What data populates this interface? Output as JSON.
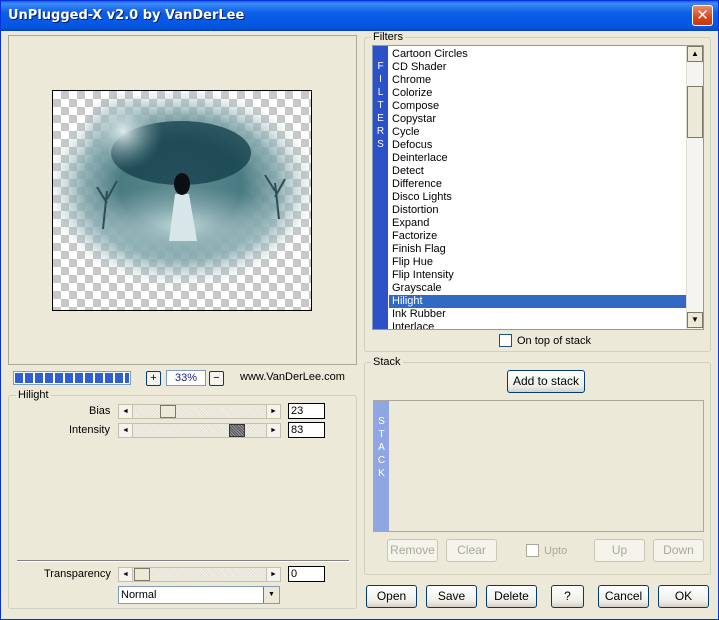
{
  "window": {
    "title": "UnPlugged-X v2.0 by VanDerLee",
    "close_symbol": "✕"
  },
  "preview": {
    "zoom": "33%",
    "zoom_in": "+",
    "zoom_out": "−",
    "website": "www.VanDerLee.com",
    "progress_percent": 100
  },
  "settings": {
    "group_label": "Hilight",
    "bias": {
      "label": "Bias",
      "value": "23"
    },
    "intensity": {
      "label": "Intensity",
      "value": "83"
    },
    "transparency": {
      "label": "Transparency",
      "value": "0"
    },
    "blend_mode": "Normal"
  },
  "filters": {
    "group_label": "Filters",
    "sidebar_letters": [
      "F",
      "I",
      "L",
      "T",
      "E",
      "R",
      "S"
    ],
    "items": [
      "Cartoon Circles",
      "CD Shader",
      "Chrome",
      "Colorize",
      "Compose",
      "Copystar",
      "Cycle",
      "Defocus",
      "Deinterlace",
      "Detect",
      "Difference",
      "Disco Lights",
      "Distortion",
      "Expand",
      "Factorize",
      "Finish Flag",
      "Flip Hue",
      "Flip Intensity",
      "Grayscale",
      "Hilight",
      "Ink Rubber",
      "Interlace"
    ],
    "selected": "Hilight",
    "on_top_label": "On top of stack"
  },
  "stack": {
    "group_label": "Stack",
    "add_label": "Add to stack",
    "sidebar_letters": [
      "S",
      "T",
      "A",
      "C",
      "K"
    ],
    "remove_label": "Remove",
    "clear_label": "Clear",
    "upto_label": "Upto",
    "up_label": "Up",
    "down_label": "Down"
  },
  "footer": {
    "open": "Open",
    "save": "Save",
    "delete": "Delete",
    "help": "?",
    "cancel": "Cancel",
    "ok": "OK"
  },
  "icons": {
    "arrow_left": "◄",
    "arrow_right": "►",
    "arrow_up": "▲",
    "arrow_down": "▼"
  }
}
